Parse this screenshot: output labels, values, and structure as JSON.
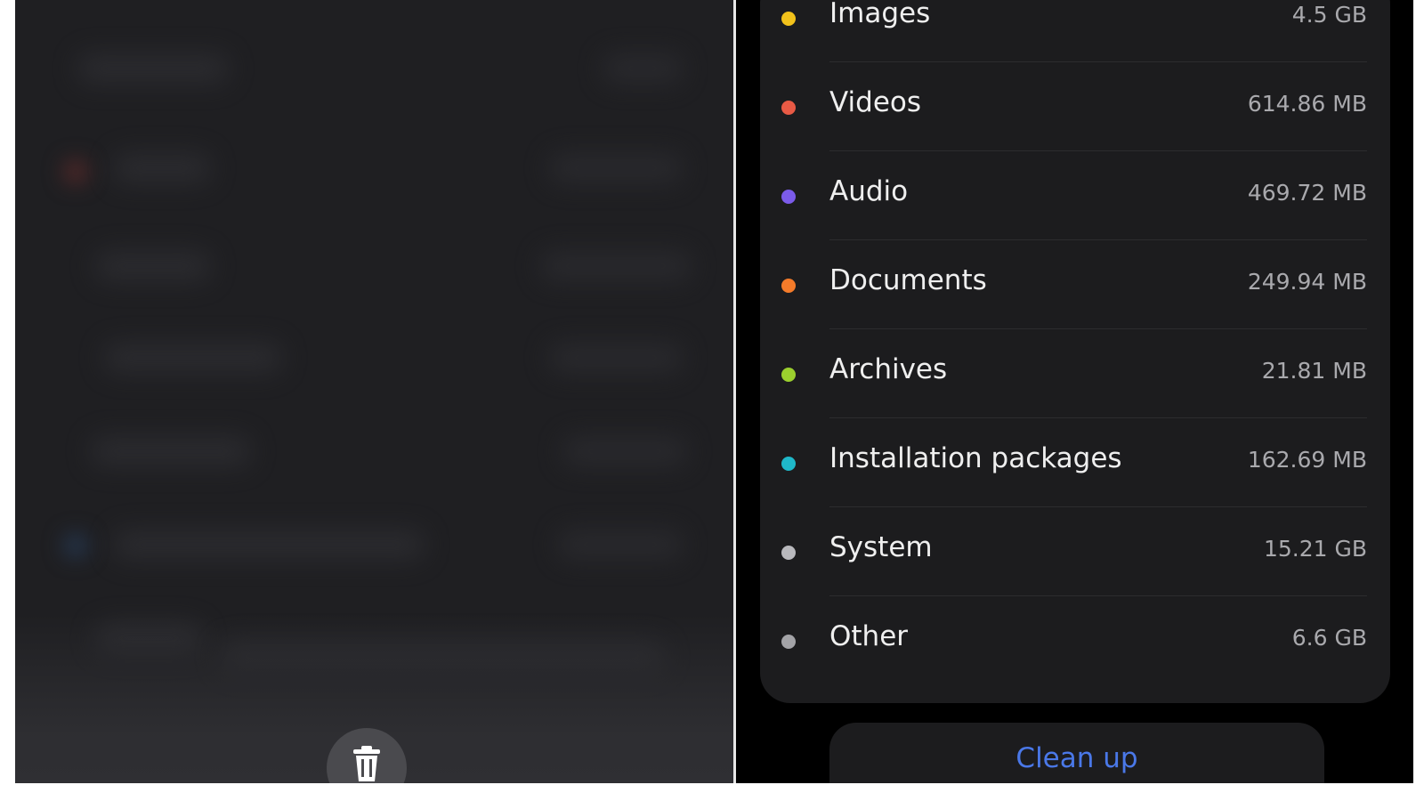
{
  "storage": {
    "categories": [
      {
        "label": "Images",
        "value": "4.5 GB",
        "color": "#f2c21b"
      },
      {
        "label": "Videos",
        "value": "614.86 MB",
        "color": "#e85a45"
      },
      {
        "label": "Audio",
        "value": "469.72 MB",
        "color": "#7b5bea"
      },
      {
        "label": "Documents",
        "value": "249.94 MB",
        "color": "#f47b2a"
      },
      {
        "label": "Archives",
        "value": "21.81 MB",
        "color": "#9bcf2e"
      },
      {
        "label": "Installation packages",
        "value": "162.69 MB",
        "color": "#1fb8c9"
      },
      {
        "label": "System",
        "value": "15.21 GB",
        "color": "#b9b9bd"
      },
      {
        "label": "Other",
        "value": "6.6 GB",
        "color": "#a3a3a7"
      }
    ],
    "cleanup_label": "Clean up"
  },
  "icons": {
    "trash": "trash-icon"
  },
  "colors": {
    "card_background": "#1c1c1e",
    "accent_blue": "#4a78e8"
  }
}
